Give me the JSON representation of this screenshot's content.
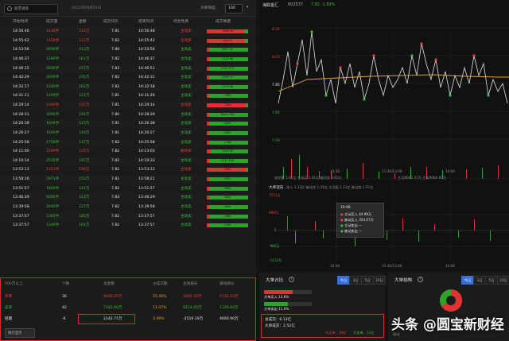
{
  "toolbar": {
    "search_placeholder": "股票搜索",
    "date_text": "2023年09月22日",
    "filter_label": "大单筛选：",
    "filter_value": "100"
  },
  "table": {
    "columns": [
      "开始时间",
      "成交量",
      "金额",
      "成交均价",
      "结束时间",
      "综合性质",
      "成交数量"
    ],
    "rows": [
      {
        "start": "14:56:46",
        "vol": "1436手",
        "amt": "112万",
        "avg": "7.81",
        "end": "14:56:48",
        "type": "主动买",
        "bar_red": 0.9,
        "bar_label": "1608  26",
        "vc": "red"
      },
      {
        "start": "14:55:42",
        "vol": "1429手",
        "amt": "112万",
        "avg": "7.82",
        "end": "14:55:42",
        "type": "主动买",
        "bar_red": 0.9,
        "bar_label": "1420  9",
        "vc": "red"
      },
      {
        "start": "14:53:56",
        "vol": "4000手",
        "amt": "313万",
        "avg": "7.80",
        "end": "14:53:56",
        "type": "主动卖",
        "bar_red": 0.05,
        "bar_label": "2097  42",
        "vc": "green"
      },
      {
        "start": "14:46:37",
        "vol": "1280手",
        "amt": "101万",
        "avg": "7.82",
        "end": "14:46:37",
        "type": "主动卖",
        "bar_red": 0.05,
        "bar_label": "1214  66",
        "vc": "green"
      },
      {
        "start": "14:46:15",
        "vol": "2000手",
        "amt": "157万",
        "avg": "7.83",
        "end": "14:46:51",
        "type": "主动卖",
        "bar_red": 0.05,
        "bar_label": "2722  213",
        "vc": "green"
      },
      {
        "start": "14:42:29",
        "vol": "3000手",
        "amt": "235万",
        "avg": "7.82",
        "end": "14:42:31",
        "type": "主动卖",
        "bar_red": 0.05,
        "bar_label": "2856  41",
        "vc": "green"
      },
      {
        "start": "14:32:17",
        "vol": "1300手",
        "amt": "102万",
        "avg": "7.82",
        "end": "14:32:18",
        "type": "主动卖",
        "bar_red": 0.05,
        "bar_label": "1214  86",
        "vc": "green"
      },
      {
        "start": "14:31:11",
        "vol": "1399手",
        "amt": "111万",
        "avg": "7.81",
        "end": "14:31:26",
        "type": "主动卖",
        "bar_red": 0.05,
        "bar_label": "1399",
        "vc": "green"
      },
      {
        "start": "14:29:14",
        "vol": "1300手",
        "amt": "101万",
        "avg": "7.81",
        "end": "14:29:14",
        "type": "主动买",
        "bar_red": 0.95,
        "bar_label": "1300",
        "vc": "red"
      },
      {
        "start": "14:28:31",
        "vol": "3000手",
        "amt": "234万",
        "avg": "7.80",
        "end": "14:28:39",
        "type": "主动卖",
        "bar_red": 0.05,
        "bar_label": "1806  2940",
        "vc": "green"
      },
      {
        "start": "14:26:38",
        "vol": "1604手",
        "amt": "125万",
        "avg": "7.81",
        "end": "14:26:38",
        "type": "主动卖",
        "bar_red": 0.05,
        "bar_label": "1604",
        "vc": "green"
      },
      {
        "start": "14:26:27",
        "vol": "1800手",
        "amt": "140万",
        "avg": "7.81",
        "end": "14:26:27",
        "type": "主动卖",
        "bar_red": 0.05,
        "bar_label": "1800",
        "vc": "green"
      },
      {
        "start": "14:25:58",
        "vol": "1756手",
        "amt": "137万",
        "avg": "7.82",
        "end": "14:25:58",
        "type": "主动卖",
        "bar_red": 0.05,
        "bar_label": "1756",
        "vc": "green"
      },
      {
        "start": "14:11:00",
        "vol": "1599手",
        "amt": "125万",
        "avg": "7.82",
        "end": "14:13:03",
        "type": "被动买",
        "bar_red": 0.1,
        "bar_label": "1534  65",
        "vc": "red"
      },
      {
        "start": "14:10:14",
        "vol": "2515手",
        "amt": "197万",
        "avg": "7.82",
        "end": "14:10:33",
        "type": "主动卖",
        "bar_red": 0.05,
        "bar_label": "2311  204",
        "vc": "green"
      },
      {
        "start": "13:53:13",
        "vol": "1353手",
        "amt": "106万",
        "avg": "7.82",
        "end": "13:53:13",
        "type": "主动买",
        "bar_red": 0.95,
        "bar_label": "1353",
        "vc": "red"
      },
      {
        "start": "13:58:16",
        "vol": "1971手",
        "amt": "153万",
        "avg": "7.81",
        "end": "13:58:21",
        "type": "主动卖",
        "bar_red": 0.05,
        "bar_label": "1971",
        "vc": "green"
      },
      {
        "start": "13:51:57",
        "vol": "1800手",
        "amt": "141万",
        "avg": "7.82",
        "end": "13:51:57",
        "type": "主动卖",
        "bar_red": 0.05,
        "bar_label": "1800",
        "vc": "green"
      },
      {
        "start": "13:46:29",
        "vol": "4000手",
        "amt": "313万",
        "avg": "7.83",
        "end": "13:46:29",
        "type": "主动卖",
        "bar_red": 0.05,
        "bar_label": "4000",
        "vc": "green"
      },
      {
        "start": "13:39:58",
        "vol": "2900手",
        "amt": "227万",
        "avg": "7.82",
        "end": "13:39:58",
        "type": "主动卖",
        "bar_red": 0.05,
        "bar_label": "2900",
        "vc": "green"
      },
      {
        "start": "13:37:57",
        "vol": "2365手",
        "amt": "185万",
        "avg": "7.82",
        "end": "13:37:57",
        "type": "主动卖",
        "bar_red": 0.05,
        "bar_label": "2365",
        "vc": "green"
      },
      {
        "start": "13:37:57",
        "vol": "1300手",
        "amt": "101万",
        "avg": "7.82",
        "end": "13:37:57",
        "type": "主动卖",
        "bar_red": 0.05,
        "bar_label": "1300",
        "vc": "green"
      }
    ]
  },
  "summary": {
    "headers": [
      "100万以上",
      "个数",
      "总金额",
      "占成交额",
      "主动部分",
      "被动部分"
    ],
    "rows": [
      {
        "name": "买单",
        "count": "36",
        "amount": "9400.35万",
        "pct": "15.46%",
        "active": "3695.40万",
        "passive": "5704.63万",
        "cls": "red"
      },
      {
        "name": "卖单",
        "count": "42",
        "amount": "7343.90万",
        "pct": "11.07%",
        "active": "6214.45万",
        "passive": "1129.84万",
        "cls": "green"
      },
      {
        "name": "轻量",
        "count": "-6",
        "amount": "2142.71万",
        "pct": "3.49%",
        "active": "-2519.19万",
        "passive": "4660.90万",
        "cls": "orange"
      }
    ],
    "stat_button": "统计显示"
  },
  "chart": {
    "stock_name": "海联金汇",
    "stock_code": "002537",
    "stock_price": "7.82  -1.89%",
    "y_labels": [
      "8.25",
      "8.05",
      "7.85",
      "7.65",
      "7.03"
    ],
    "x_labels": [
      "10:30",
      "11:30/13:00",
      "14:00"
    ],
    "vol_info": "成交量  1.01亿  主动买 1.01亿  被动卖 3.61亿",
    "vol_info2": "主买8662.37万  主卖9066.95万",
    "flow_label": "大单流向",
    "flow_info": "流入  1.13亿  被动卖 1.41亿  主动卖 1.13亿  被动卖 1.41亿",
    "flow_y": [
      "1111万",
      "986万",
      "0",
      "-986万",
      "-1112万"
    ],
    "tooltip": {
      "time": "10:06",
      "items": [
        {
          "label": "主动买入",
          "value": "44.99万"
        },
        {
          "label": "被动买入",
          "value": "354.07万"
        },
        {
          "label": "主动卖出",
          "value": "一"
        },
        {
          "label": "被动卖出",
          "value": "一"
        }
      ]
    },
    "flow_x": [
      "10:30",
      "11:30/13:00",
      "14:00"
    ]
  },
  "panel1": {
    "title": "大单占比",
    "tabs": [
      "今日",
      "3日",
      "5日",
      "10日"
    ],
    "bar1_label": "大单买入 13.6%",
    "bar2_label": "大单卖出 11.0%",
    "total": "总成交：6.13亿",
    "big": "大单成交：2.52亿",
    "buy_note": "大买单：19亿",
    "sell_note": "大卖单：13亿"
  },
  "panel2": {
    "title": "大单结构",
    "tabs": [
      "今日",
      "3日",
      "5日",
      "10日"
    ],
    "legend": "拨动"
  },
  "watermark": {
    "text": "头条 @圆宝新财经"
  },
  "colors": {
    "up": "#e8403a",
    "down": "#3bbf3b",
    "accent": "#3a6fd9",
    "alert": "#d42b2b"
  }
}
